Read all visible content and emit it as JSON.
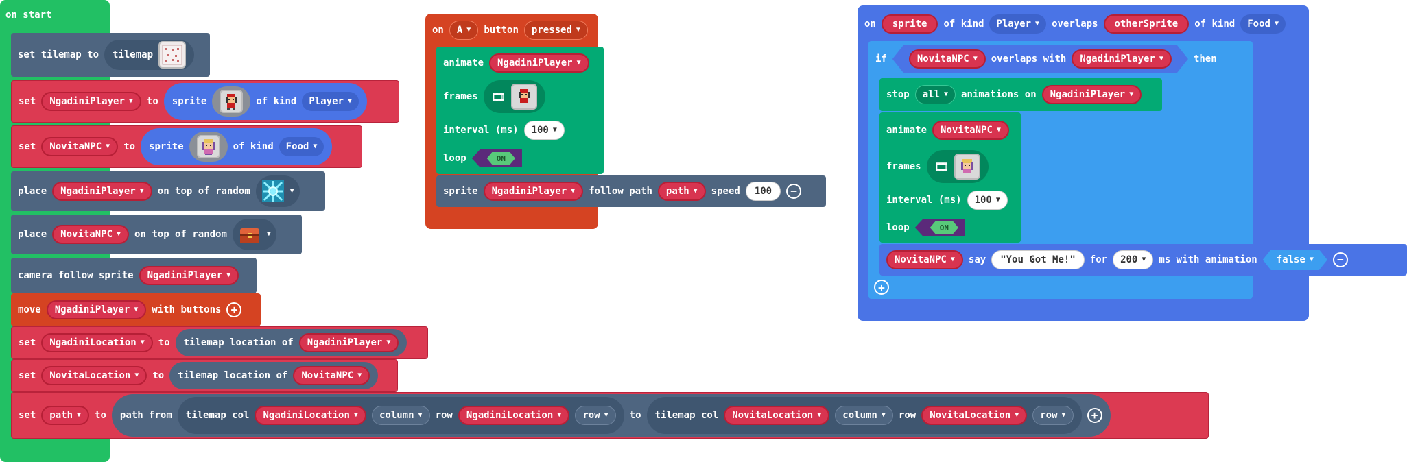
{
  "colors": {
    "event_green": "#22c064",
    "variables_red": "#dc3a52",
    "scene_slate": "#4e6580",
    "controller_orange": "#d54322",
    "animation_green": "#03aa74",
    "sprites_blue": "#4a74e6",
    "logic_light_blue": "#3c9ef0"
  },
  "on_start": {
    "hat": "on start",
    "set_tilemap": {
      "set": "set tilemap to",
      "tilemap": "tilemap"
    },
    "set_player": {
      "set": "set",
      "var": "NgadiniPlayer",
      "to": "to",
      "sprite": "sprite",
      "of_kind": "of kind",
      "kind": "Player"
    },
    "set_npc": {
      "set": "set",
      "var": "NovitaNPC",
      "to": "to",
      "sprite": "sprite",
      "of_kind": "of kind",
      "kind": "Food"
    },
    "place_player": {
      "place": "place",
      "var": "NgadiniPlayer",
      "rest": "on top of random"
    },
    "place_npc": {
      "place": "place",
      "var": "NovitaNPC",
      "rest": "on top of random"
    },
    "camera": {
      "text": "camera follow sprite",
      "var": "NgadiniPlayer"
    },
    "move": {
      "move": "move",
      "var": "NgadiniPlayer",
      "rest": "with buttons"
    },
    "set_loc1": {
      "set": "set",
      "var": "NgadiniLocation",
      "to": "to",
      "tl": "tilemap location of",
      "of": "NgadiniPlayer"
    },
    "set_loc2": {
      "set": "set",
      "var": "NovitaLocation",
      "to": "to",
      "tl": "tilemap location of",
      "of": "NovitaNPC"
    },
    "set_path": {
      "set": "set",
      "var": "path",
      "to": "to",
      "path_from": "path from",
      "tc1": "tilemap col",
      "v1": "NgadiniLocation",
      "c1": "column",
      "row1": "row",
      "v1b": "NgadiniLocation",
      "r1": "row",
      "to2": "to",
      "tc2": "tilemap col",
      "v2": "NovitaLocation",
      "c2": "column",
      "row2": "row",
      "v2b": "NovitaLocation",
      "r2": "row"
    }
  },
  "on_a": {
    "on": "on",
    "button": "A",
    "button_word": "button",
    "event": "pressed",
    "animate": "animate",
    "anim_var": "NgadiniPlayer",
    "frames": "frames",
    "interval": "interval (ms)",
    "interval_val": "100",
    "loop": "loop",
    "loop_val": "ON",
    "sprite": "sprite",
    "sprite_var": "NgadiniPlayer",
    "follow": "follow path",
    "path": "path",
    "speed": "speed",
    "speed_val": "100"
  },
  "overlap": {
    "on": "on",
    "sprite": "sprite",
    "of_kind": "of kind",
    "kind1": "Player",
    "overlaps": "overlaps",
    "other": "otherSprite",
    "of_kind2": "of kind",
    "kind2": "Food",
    "if": "if",
    "npc": "NovitaNPC",
    "overlaps_with": "overlaps with",
    "player": "NgadiniPlayer",
    "then": "then",
    "stop": "stop",
    "all": "all",
    "anims_on": "animations on",
    "stop_var": "NgadiniPlayer",
    "animate": "animate",
    "anim_var": "NovitaNPC",
    "frames": "frames",
    "interval": "interval (ms)",
    "interval_val": "100",
    "loop": "loop",
    "loop_val": "ON",
    "say_var": "NovitaNPC",
    "say": "say",
    "say_text": "\"You Got Me!\"",
    "for": "for",
    "ms": "200",
    "with_anim": "ms with animation",
    "anim_bool": "false"
  }
}
